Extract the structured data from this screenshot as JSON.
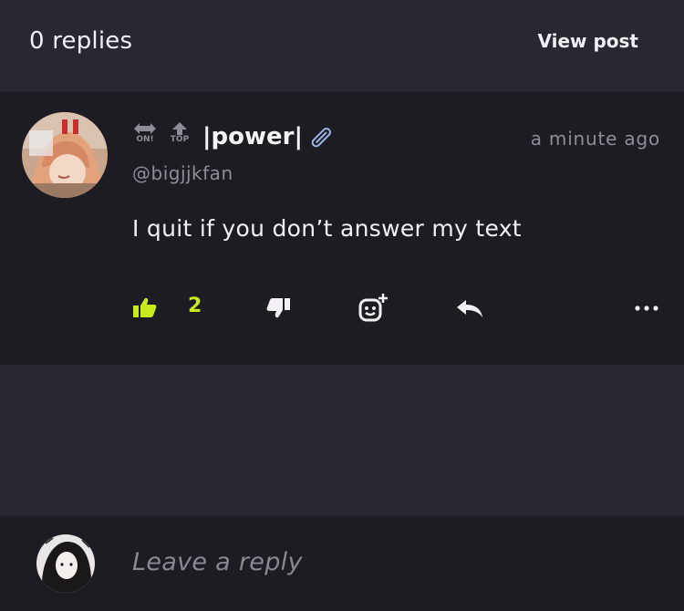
{
  "header": {
    "replies_count": "0 replies",
    "view_post_label": "View post"
  },
  "comment": {
    "badges": [
      {
        "icon": "swap-arrows-icon",
        "label": "ON!"
      },
      {
        "icon": "up-arrow-icon",
        "label": "TOP"
      }
    ],
    "display_name": "|power|",
    "name_icon": "safety-pin-icon",
    "handle": "@bigjjkfan",
    "timestamp": "a minute ago",
    "text": "I quit if you don’t answer my text",
    "likes": "2",
    "accent_color": "#c6ea1e"
  },
  "actions": {
    "like_icon": "thumbs-up-icon",
    "dislike_icon": "thumbs-down-icon",
    "react_icon": "add-reaction-icon",
    "reply_icon": "reply-arrow-icon",
    "more_icon": "more-dots-icon"
  },
  "reply_bar": {
    "placeholder": "Leave a reply"
  }
}
